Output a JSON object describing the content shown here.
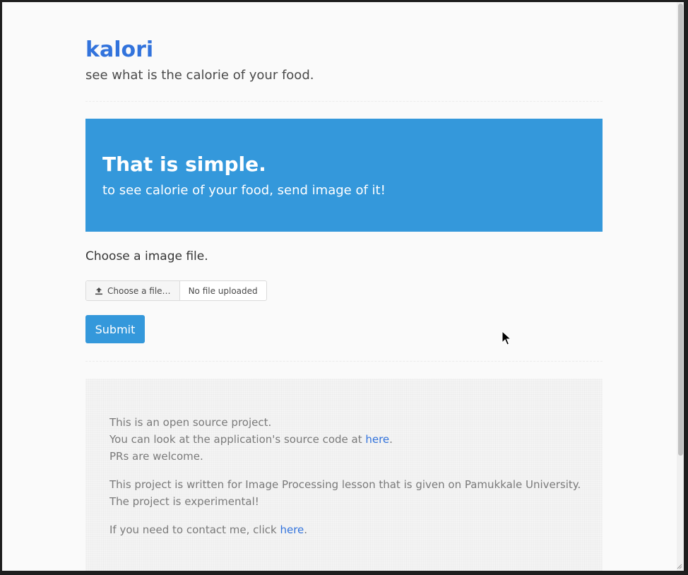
{
  "header": {
    "title": "kalori",
    "subtitle": "see what is the calorie of your food."
  },
  "hero": {
    "title": "That is simple.",
    "subtitle": "to see calorie of your food, send image of it!"
  },
  "form": {
    "label": "Choose a image file.",
    "file_button_label": "Choose a file…",
    "file_button_icon": "upload-icon",
    "file_name": "No file uploaded",
    "submit_label": "Submit"
  },
  "footer": {
    "line1": "This is an open source project.",
    "line2_prefix": "You can look at the application's source code at ",
    "line2_link": "here",
    "line2_suffix": ".",
    "line3": "PRs are welcome.",
    "line4": "This project is written for Image Processing lesson that is given on Pamukkale University.",
    "line5": "The project is experimental!",
    "line6_prefix": "If you need to contact me, click ",
    "line6_link": "here",
    "line6_suffix": "."
  },
  "colors": {
    "accent": "#3273dc",
    "hero_bg": "#3498db",
    "button_bg": "#3498db"
  }
}
